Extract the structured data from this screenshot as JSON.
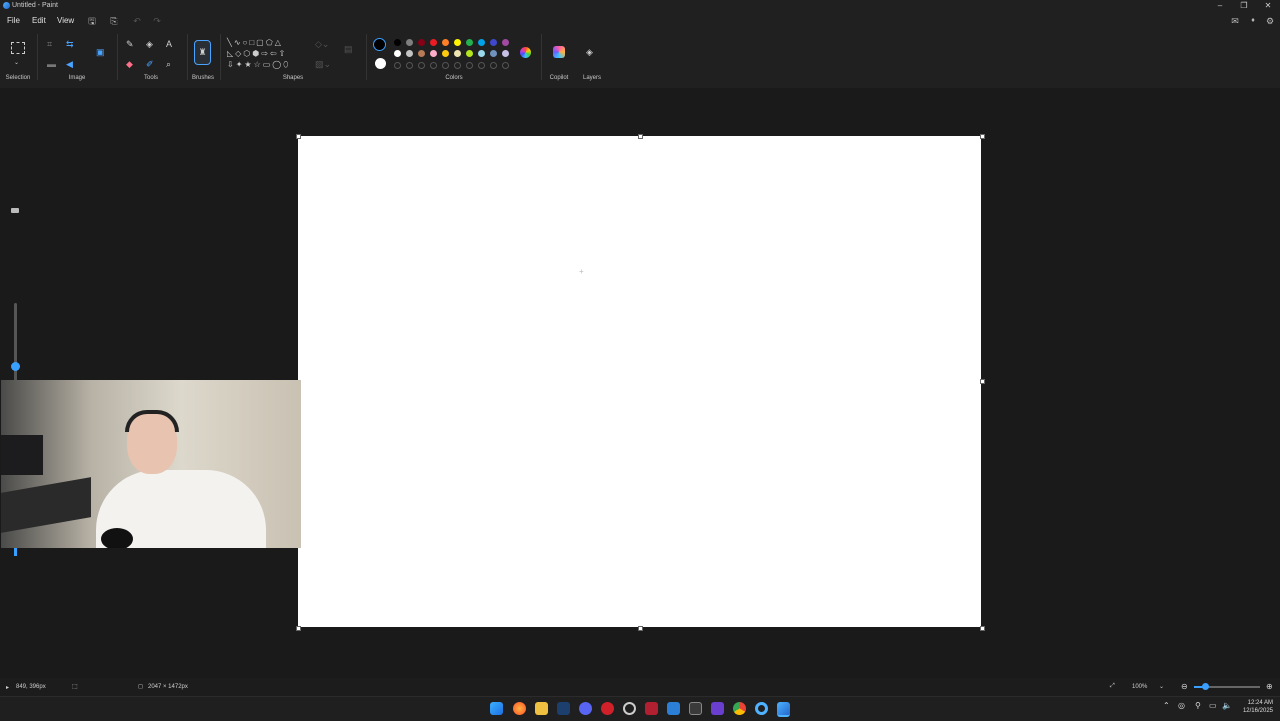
{
  "window": {
    "title": "Untitled - Paint",
    "minimize": "–",
    "maximize": "❐",
    "close": "✕"
  },
  "menu": {
    "file": "File",
    "edit": "Edit",
    "view": "View"
  },
  "ribbon": {
    "groups": {
      "selection": "Selection",
      "image": "Image",
      "tools": "Tools",
      "brushes": "Brushes",
      "shapes": "Shapes",
      "colors": "Colors",
      "copilot": "Copilot",
      "layers": "Layers"
    },
    "text_tool": "A",
    "colors": {
      "primary": "#000000",
      "secondary": "#ffffff",
      "row1": [
        "#000000",
        "#7f7f7f",
        "#880015",
        "#ed1c24",
        "#ff7f27",
        "#fff200",
        "#22b14c",
        "#00a2e8",
        "#3f48cc",
        "#a349a4"
      ],
      "row2": [
        "#ffffff",
        "#c3c3c3",
        "#b97a57",
        "#ffaec9",
        "#ffc90e",
        "#efe4b0",
        "#b5e61d",
        "#99d9ea",
        "#7092be",
        "#c8bfe7"
      ]
    }
  },
  "status": {
    "cursor_position": "849, 396px",
    "canvas_size": "2047 × 1472px",
    "zoom": "100%"
  },
  "taskbar": {
    "time": "12:24 AM",
    "date": "12/16/2025"
  }
}
